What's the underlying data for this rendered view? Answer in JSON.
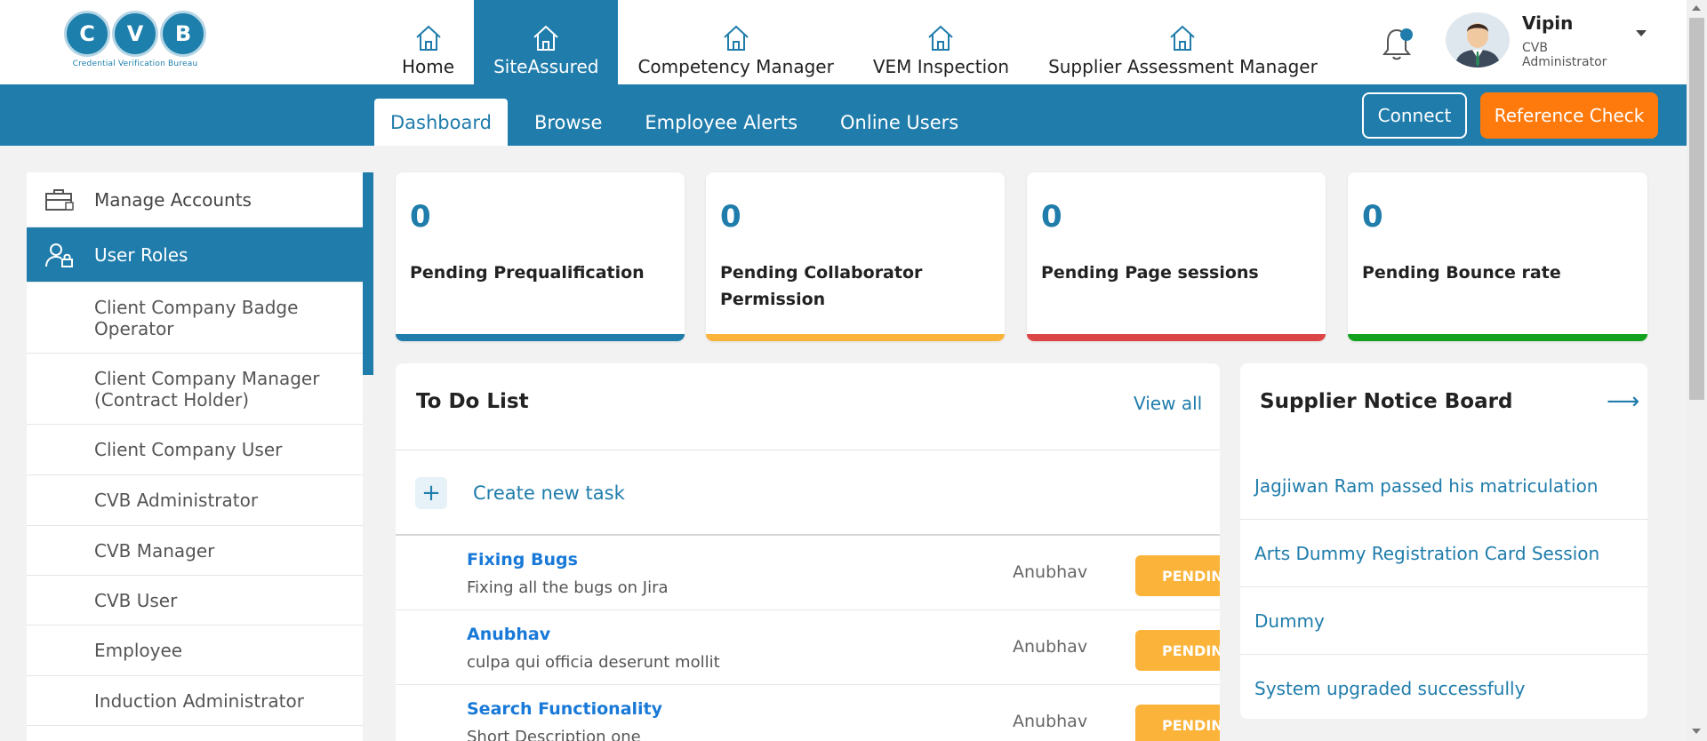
{
  "logo": {
    "letters": [
      "C",
      "V",
      "B"
    ],
    "tagline": "Credential Verification Bureau"
  },
  "nav": {
    "tabs": [
      {
        "label": "Home",
        "icon": "house-icon"
      },
      {
        "label": "SiteAssured",
        "icon": "house-icon",
        "active": true
      },
      {
        "label": "Competency Manager",
        "icon": "house-icon"
      },
      {
        "label": "VEM Inspection",
        "icon": "house-icon"
      },
      {
        "label": "Supplier Assessment Manager",
        "icon": "house-icon"
      }
    ]
  },
  "user": {
    "name": "Vipin",
    "role": "CVB Administrator",
    "icon": "bell-icon"
  },
  "subnav": {
    "tabs": [
      "Dashboard",
      "Browse",
      "Employee Alerts",
      "Online Users"
    ],
    "connect_label": "Connect",
    "reference_label": "Reference Check"
  },
  "sidebar": {
    "items": [
      {
        "label": "Manage Accounts",
        "icon": "briefcase-icon"
      },
      {
        "label": "User Roles",
        "icon": "user-lock-icon",
        "active": true
      }
    ],
    "sub_items": [
      "Client Company Badge Operator",
      "Client Company Manager (Contract Holder)",
      "Client Company User",
      "CVB Administrator",
      "CVB Manager",
      "CVB User",
      "Employee",
      "Induction Administrator"
    ]
  },
  "cards": [
    {
      "value": "0",
      "label": "Pending Prequalification",
      "color": "#1f7cab"
    },
    {
      "value": "0",
      "label": "Pending Collaborator Permission",
      "color": "#fbb33a"
    },
    {
      "value": "0",
      "label": "Pending Page sessions",
      "color": "#dc4545"
    },
    {
      "value": "0",
      "label": "Pending Bounce rate",
      "color": "#12a21d"
    }
  ],
  "todo": {
    "title": "To Do List",
    "view_all": "View all",
    "create_label": "Create new task",
    "tasks": [
      {
        "title": "Fixing Bugs",
        "desc": "Fixing all the bugs on Jira",
        "owner": "Anubhav",
        "status": "PENDIN"
      },
      {
        "title": "Anubhav",
        "desc": "culpa qui officia deserunt mollit",
        "owner": "Anubhav",
        "status": "PENDIN"
      },
      {
        "title": "Search Functionality",
        "desc": "Short Description one",
        "owner": "Anubhav",
        "status": "PENDIN"
      }
    ]
  },
  "notice": {
    "title": "Supplier Notice Board",
    "items": [
      "Jagjiwan Ram passed his matriculation",
      "Arts Dummy Registration Card Session",
      "Dummy",
      "System upgraded successfully"
    ]
  }
}
